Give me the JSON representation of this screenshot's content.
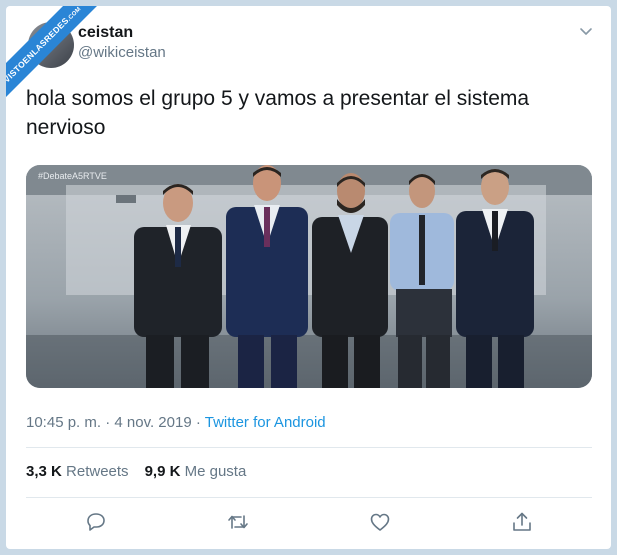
{
  "watermark": {
    "text": "VISTOENLASREDES",
    "suffix": ".COM"
  },
  "author": {
    "display_name": "ceistan",
    "handle": "@wikiceistan"
  },
  "tweet": {
    "text": "hola somos el grupo 5 y vamos a presentar el sistema nervioso"
  },
  "media": {
    "hashtag": "#DebateA5RTVE",
    "description_icon": "photo-five-men-in-suits"
  },
  "meta": {
    "time": "10:45 p. m.",
    "date": "4 nov. 2019",
    "separator": " · ",
    "source": "Twitter for Android"
  },
  "stats": {
    "retweets_count": "3,3 K",
    "retweets_label": "Retweets",
    "likes_count": "9,9 K",
    "likes_label": "Me gusta"
  },
  "actions": [
    "reply-icon",
    "retweet-icon",
    "like-icon",
    "share-icon"
  ],
  "colors": {
    "link": "#1b95e0",
    "muted": "#657786",
    "text": "#14171a",
    "watermark": "#2a85d6"
  }
}
